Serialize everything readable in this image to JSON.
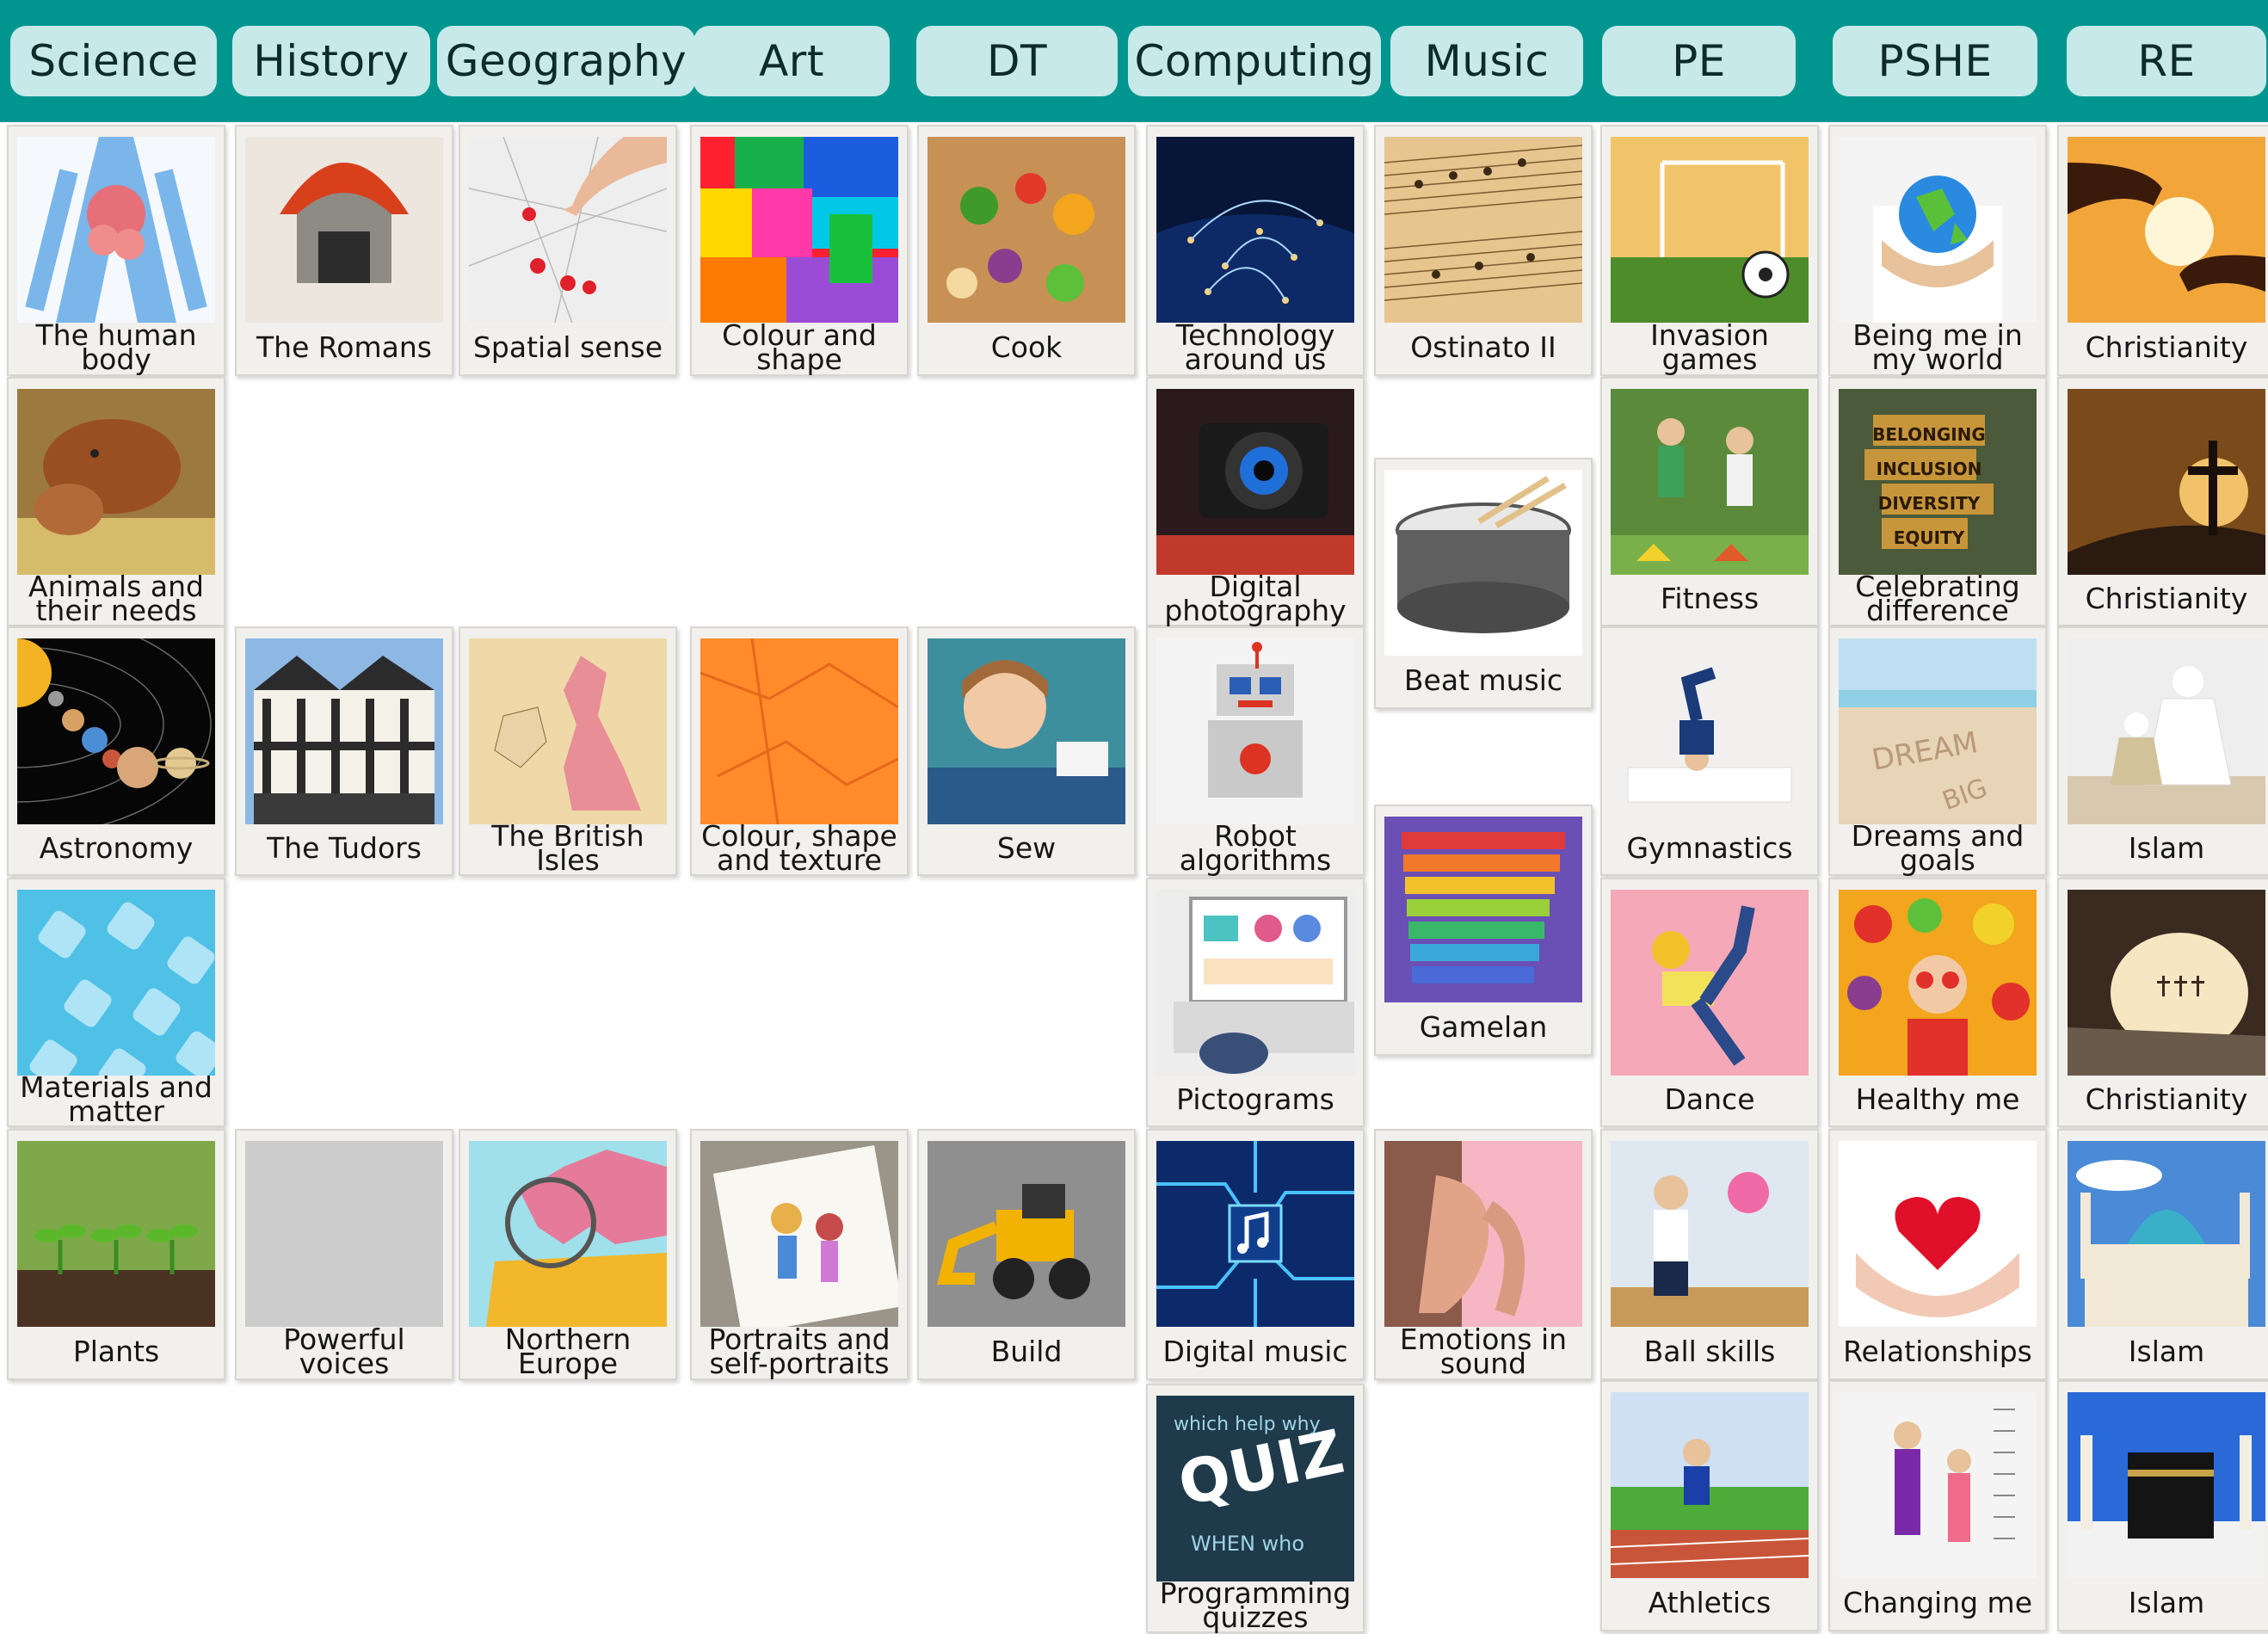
{
  "subjects": [
    {
      "label": "Science"
    },
    {
      "label": "History"
    },
    {
      "label": "Geography"
    },
    {
      "label": "Art"
    },
    {
      "label": "DT"
    },
    {
      "label": "Computing"
    },
    {
      "label": "Music"
    },
    {
      "label": "PE"
    },
    {
      "label": "PSHE"
    },
    {
      "label": "RE"
    }
  ],
  "topics": {
    "science": [
      {
        "label": "The human body",
        "icon": "human-body-icon"
      },
      {
        "label": "Animals and their needs",
        "icon": "cow-calf-icon"
      },
      {
        "label": "Astronomy",
        "icon": "solar-system-icon"
      },
      {
        "label": "Materials and matter",
        "icon": "ice-cubes-icon"
      },
      {
        "label": "Plants",
        "icon": "seedlings-icon"
      }
    ],
    "history": [
      {
        "label": "The Romans",
        "icon": "roman-helmet-icon"
      },
      {
        "label": "The Tudors",
        "icon": "tudor-house-icon"
      },
      {
        "label": "Powerful voices",
        "icon": "crowd-engraving-icon"
      }
    ],
    "geography": [
      {
        "label": "Spatial sense",
        "icon": "map-pins-icon"
      },
      {
        "label": "The British Isles",
        "icon": "british-isles-map-icon"
      },
      {
        "label": "Northern Europe",
        "icon": "europe-map-icon"
      }
    ],
    "art": [
      {
        "label": "Colour and shape",
        "icon": "colour-blocks-icon"
      },
      {
        "label": "Colour, shape and texture",
        "icon": "crumpled-paper-icon"
      },
      {
        "label": "Portraits and self-portraits",
        "icon": "child-drawing-icon"
      }
    ],
    "dt": [
      {
        "label": "Cook",
        "icon": "vegetables-icon"
      },
      {
        "label": "Sew",
        "icon": "boy-sewing-icon"
      },
      {
        "label": "Build",
        "icon": "toy-digger-icon"
      }
    ],
    "computing": [
      {
        "label": "Technology around us",
        "icon": "network-globe-icon"
      },
      {
        "label": "Digital photography",
        "icon": "camera-icon"
      },
      {
        "label": "Robot algorithms",
        "icon": "toy-robot-icon"
      },
      {
        "label": "Pictograms",
        "icon": "laptop-charts-icon"
      },
      {
        "label": "Digital music",
        "icon": "circuit-note-icon"
      },
      {
        "label": "Programming quizzes",
        "icon": "quiz-words-icon"
      }
    ],
    "music": [
      {
        "label": "Ostinato II",
        "icon": "sheet-music-icon"
      },
      {
        "label": "Beat music",
        "icon": "snare-drum-icon"
      },
      {
        "label": "Gamelan",
        "icon": "xylophone-icon"
      },
      {
        "label": "Emotions in sound",
        "icon": "listening-ear-icon"
      }
    ],
    "pe": [
      {
        "label": "Invasion games",
        "icon": "football-goal-icon"
      },
      {
        "label": "Fitness",
        "icon": "running-children-icon"
      },
      {
        "label": "Gymnastics",
        "icon": "handstand-icon"
      },
      {
        "label": "Dance",
        "icon": "dancing-child-icon"
      },
      {
        "label": "Ball skills",
        "icon": "ball-throw-icon"
      },
      {
        "label": "Athletics",
        "icon": "running-track-icon"
      }
    ],
    "pshe": [
      {
        "label": "Being me in my world",
        "icon": "globe-hands-icon"
      },
      {
        "label": "Celebrating difference",
        "icon": "word-blocks-icon",
        "words": [
          "BELONGING",
          "INCLUSION",
          "DIVERSITY",
          "EQUITY"
        ]
      },
      {
        "label": "Dreams and goals",
        "icon": "sand-writing-icon"
      },
      {
        "label": "Healthy me",
        "icon": "fruit-veg-icon"
      },
      {
        "label": "Relationships",
        "icon": "heart-hands-icon"
      },
      {
        "label": "Changing me",
        "icon": "height-chart-icon"
      }
    ],
    "re": [
      {
        "label": "Christianity",
        "icon": "reaching-hands-icon"
      },
      {
        "label": "Christianity",
        "icon": "cross-sunset-icon"
      },
      {
        "label": "Islam",
        "icon": "prayer-icon"
      },
      {
        "label": "Christianity",
        "icon": "empty-tomb-icon"
      },
      {
        "label": "Islam",
        "icon": "mosque-icon"
      },
      {
        "label": "Islam",
        "icon": "kaaba-icon"
      }
    ]
  },
  "colors": {
    "header": "#009690",
    "tab": "#c7e9e9",
    "card": "#f1f0ec"
  }
}
